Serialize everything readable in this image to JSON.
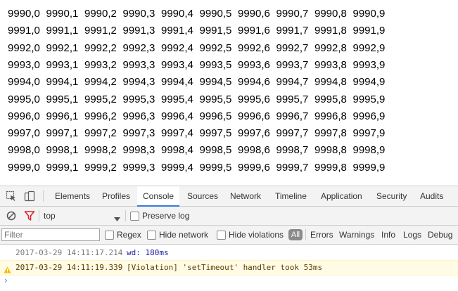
{
  "page": {
    "rows": [
      [
        "9990,0",
        "9990,1",
        "9990,2",
        "9990,3",
        "9990,4",
        "9990,5",
        "9990,6",
        "9990,7",
        "9990,8",
        "9990,9"
      ],
      [
        "9991,0",
        "9991,1",
        "9991,2",
        "9991,3",
        "9991,4",
        "9991,5",
        "9991,6",
        "9991,7",
        "9991,8",
        "9991,9"
      ],
      [
        "9992,0",
        "9992,1",
        "9992,2",
        "9992,3",
        "9992,4",
        "9992,5",
        "9992,6",
        "9992,7",
        "9992,8",
        "9992,9"
      ],
      [
        "9993,0",
        "9993,1",
        "9993,2",
        "9993,3",
        "9993,4",
        "9993,5",
        "9993,6",
        "9993,7",
        "9993,8",
        "9993,9"
      ],
      [
        "9994,0",
        "9994,1",
        "9994,2",
        "9994,3",
        "9994,4",
        "9994,5",
        "9994,6",
        "9994,7",
        "9994,8",
        "9994,9"
      ],
      [
        "9995,0",
        "9995,1",
        "9995,2",
        "9995,3",
        "9995,4",
        "9995,5",
        "9995,6",
        "9995,7",
        "9995,8",
        "9995,9"
      ],
      [
        "9996,0",
        "9996,1",
        "9996,2",
        "9996,3",
        "9996,4",
        "9996,5",
        "9996,6",
        "9996,7",
        "9996,8",
        "9996,9"
      ],
      [
        "9997,0",
        "9997,1",
        "9997,2",
        "9997,3",
        "9997,4",
        "9997,5",
        "9997,6",
        "9997,7",
        "9997,8",
        "9997,9"
      ],
      [
        "9998,0",
        "9998,1",
        "9998,2",
        "9998,3",
        "9998,4",
        "9998,5",
        "9998,6",
        "9998,7",
        "9998,8",
        "9998,9"
      ],
      [
        "9999,0",
        "9999,1",
        "9999,2",
        "9999,3",
        "9999,4",
        "9999,5",
        "9999,6",
        "9999,7",
        "9999,8",
        "9999,9"
      ]
    ]
  },
  "devtools": {
    "toolbar_icons": [
      "inspect-element-icon",
      "device-toolbar-icon"
    ],
    "tabs": [
      {
        "label": "Elements",
        "active": false
      },
      {
        "label": "Profiles",
        "active": false
      },
      {
        "label": "Console",
        "active": true
      },
      {
        "label": "Sources",
        "active": false
      },
      {
        "label": "Network",
        "active": false
      },
      {
        "label": "Timeline",
        "active": false
      },
      {
        "label": "Application",
        "active": false
      },
      {
        "label": "Security",
        "active": false
      },
      {
        "label": "Audits",
        "active": false
      }
    ],
    "console_toolbar": {
      "clear_icon": "clear-console-icon",
      "filter_icon": "filter-icon",
      "context": "top",
      "preserve_log_label": "Preserve log"
    },
    "filter_bar": {
      "placeholder": "Filter",
      "regex_label": "Regex",
      "hide_network_label": "Hide network",
      "hide_violations_label": "Hide violations",
      "levels": [
        "All",
        "Errors",
        "Warnings",
        "Info",
        "Logs",
        "Debug"
      ],
      "active_level": "All"
    },
    "messages": [
      {
        "type": "info",
        "timestamp": "2017-03-29 14:11:17.214",
        "text": "wd: 180ms"
      },
      {
        "type": "warning",
        "timestamp": "2017-03-29 14:11:19.339",
        "text": "[Violation] 'setTimeout' handler took 53ms"
      }
    ],
    "prompt_symbol": "›"
  },
  "colors": {
    "accent": "#3879d9",
    "warning_bg": "#fffbe5",
    "warning_icon": "#f4bd00",
    "filter_icon": "#e0202d",
    "info_text": "#1a1aa6"
  }
}
